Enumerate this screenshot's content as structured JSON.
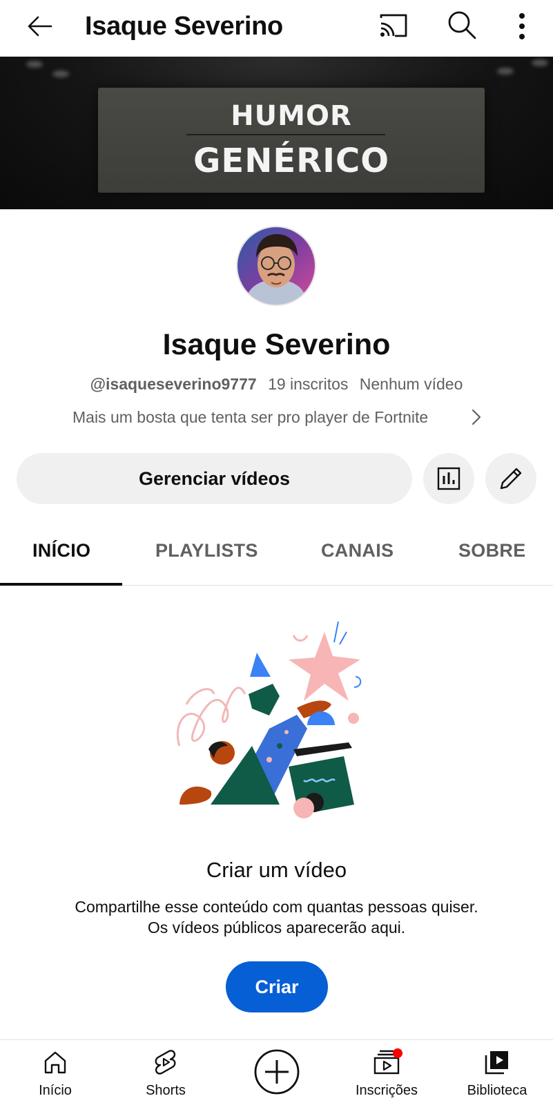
{
  "appbar": {
    "title": "Isaque Severino",
    "icons": [
      "back-arrow-icon",
      "cast-icon",
      "search-icon",
      "more-vert-icon"
    ]
  },
  "banner": {
    "line1": "HUMOR",
    "line2": "GENÉRICO"
  },
  "channel": {
    "name": "Isaque Severino",
    "handle": "@isaqueseverino9777",
    "subscribers": "19 inscritos",
    "videos": "Nenhum vídeo",
    "description": "Mais um bosta que tenta ser pro player de Fortnite"
  },
  "actions": {
    "manage_label": "Gerenciar vídeos",
    "icons": [
      "analytics-icon",
      "edit-pencil-icon"
    ]
  },
  "tabs": [
    {
      "label": "INÍCIO",
      "active": true
    },
    {
      "label": "PLAYLISTS",
      "active": false
    },
    {
      "label": "CANAIS",
      "active": false
    },
    {
      "label": "SOBRE",
      "active": false
    }
  ],
  "empty_state": {
    "title": "Criar um vídeo",
    "desc_line1": "Compartilhe esse conteúdo com quantas pessoas quiser.",
    "desc_line2": "Os vídeos públicos aparecerão aqui.",
    "button_label": "Criar"
  },
  "bottom_nav": [
    {
      "label": "Início",
      "icon": "home-icon"
    },
    {
      "label": "Shorts",
      "icon": "shorts-icon"
    },
    {
      "label": "",
      "icon": "add-circle-icon"
    },
    {
      "label": "Inscrições",
      "icon": "subscriptions-icon",
      "badge": true
    },
    {
      "label": "Biblioteca",
      "icon": "library-icon"
    }
  ],
  "colors": {
    "primary_button": "#065fd4",
    "notification_dot": "#ff0000",
    "secondary_text": "#606060",
    "chip_bg": "#f0f0f0"
  }
}
